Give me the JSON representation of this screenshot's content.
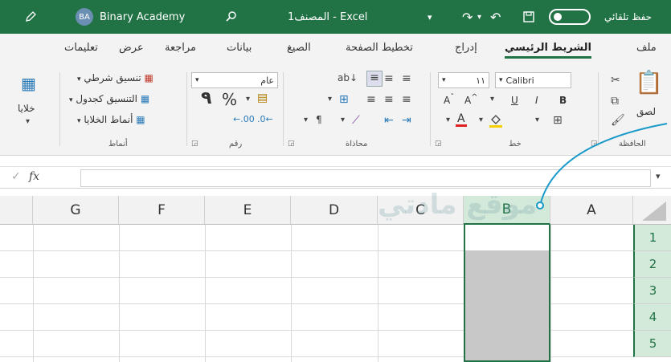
{
  "titlebar": {
    "autosave_label": "حفظ تلقائي",
    "filename": "المصنف1  -  Excel",
    "user_initials": "BA",
    "user_name": "Binary Academy",
    "save_icon": "floppy-icon",
    "undo_icon": "undo-icon",
    "redo_icon": "redo-icon",
    "search_icon": "search-icon",
    "pen_icon": "pen-icon"
  },
  "tabs": [
    "ملف",
    "الشريط الرئيسي",
    "إدراج",
    "تخطيط الصفحة",
    "الصيغ",
    "بيانات",
    "مراجعة",
    "عرض",
    "تعليمات"
  ],
  "ribbon": {
    "clipboard": {
      "label": "الحافظة",
      "paste": "لصق"
    },
    "font": {
      "label": "خط",
      "name": "Calibri",
      "size": "١١",
      "bold": "B",
      "italic": "I",
      "underline": "U"
    },
    "alignment": {
      "label": "محاذاة"
    },
    "number": {
      "label": "رقم",
      "format": "عام",
      "percent": "%",
      "comma": "٩"
    },
    "styles": {
      "label": "أنماط",
      "conditional": "تنسيق شرطي",
      "table": "التنسيق كجدول",
      "cell_styles": "أنماط الخلايا"
    },
    "cells": {
      "label": "خلايا"
    }
  },
  "formula_bar": {
    "fx": "fx",
    "value": ""
  },
  "grid": {
    "columns": [
      "A",
      "B",
      "C",
      "D",
      "E",
      "F",
      "G"
    ],
    "rows": [
      "1",
      "2",
      "3",
      "4",
      "5"
    ],
    "selected_column": "B"
  },
  "watermark": "موقع مادتي"
}
